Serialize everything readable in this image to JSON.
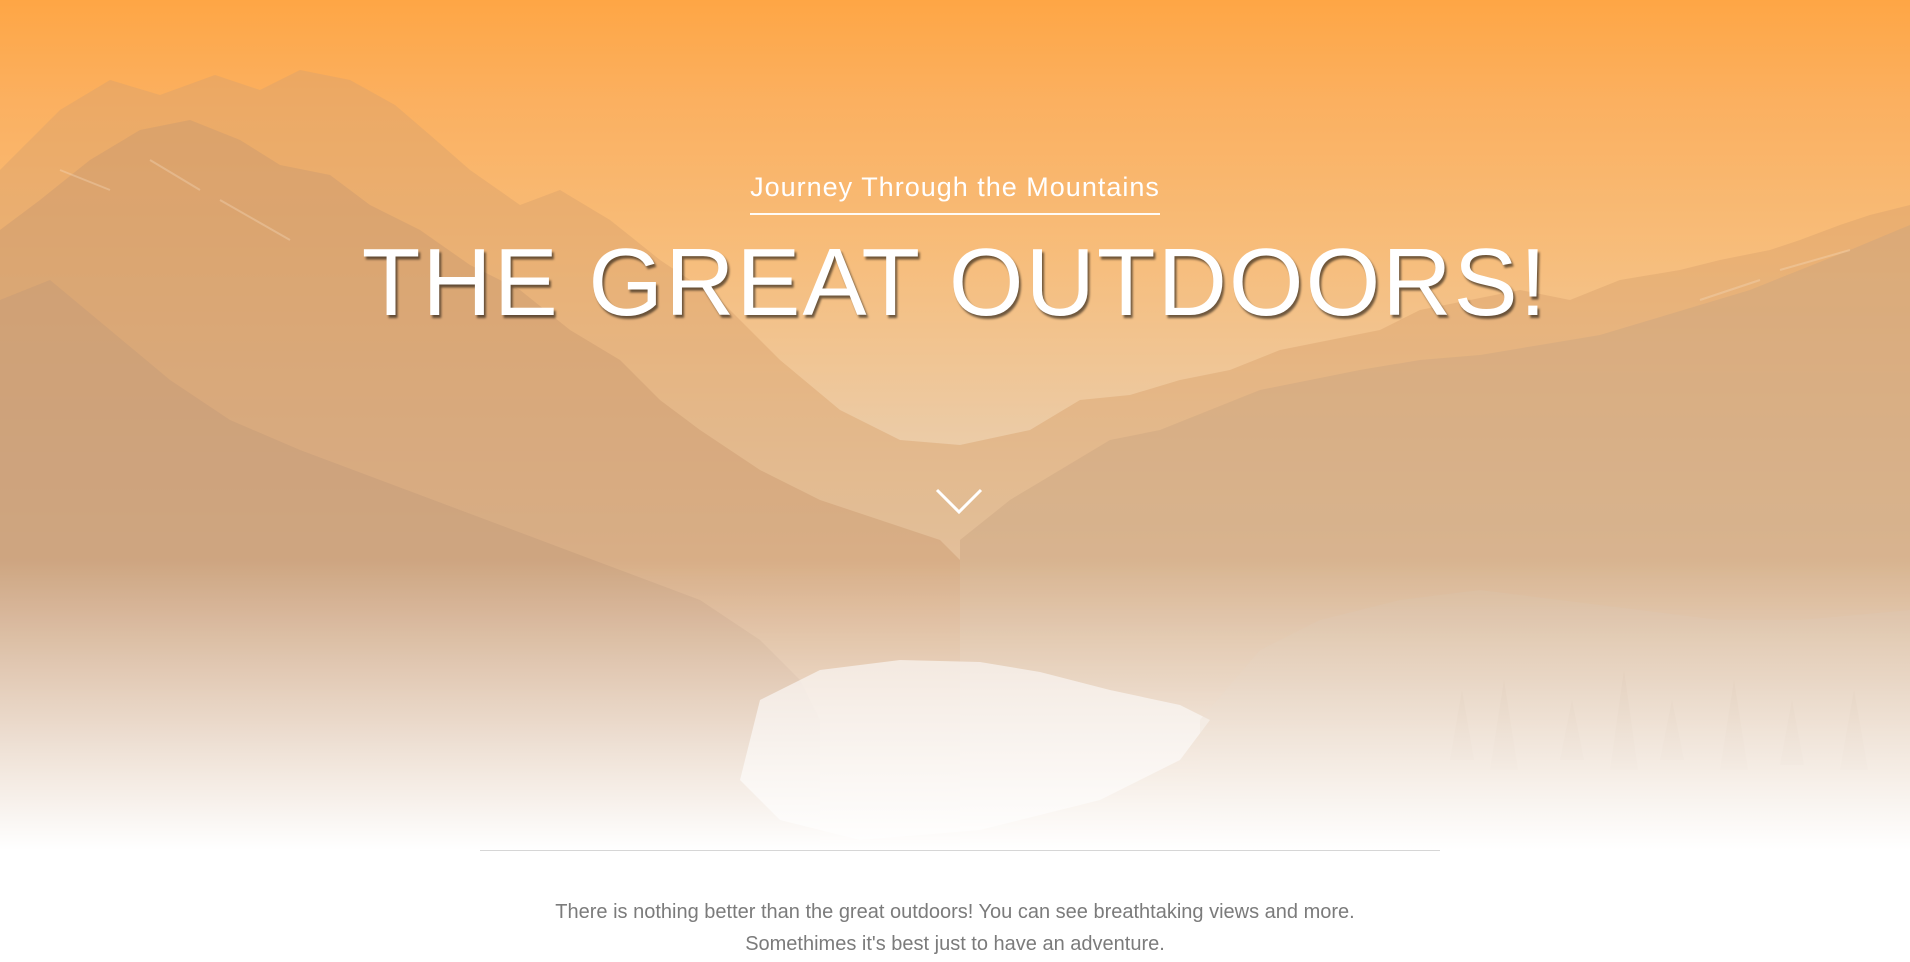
{
  "hero": {
    "subtitle": "Journey Through the Mountains",
    "title": "THE GREAT OUTDOORS!",
    "scroll_icon": "chevron-down-icon"
  },
  "intro": {
    "line1": "There is nothing better than the great outdoors! You can see breathtaking views and more.",
    "line2": "Somethimes it's best just to have an adventure."
  },
  "colors": {
    "hero_top": "#fea645",
    "text_white": "#ffffff",
    "body_text": "#7b7b7b",
    "divider": "#d6d6d6"
  }
}
